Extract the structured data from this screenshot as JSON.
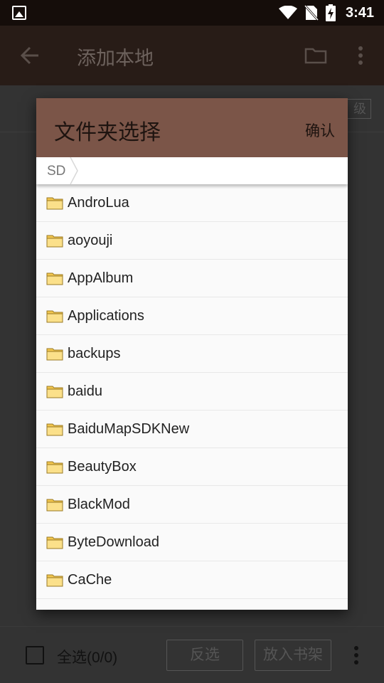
{
  "status_bar": {
    "time": "3:41"
  },
  "app_bar": {
    "title": "添加本地"
  },
  "page": {
    "chip_label": "级"
  },
  "bottom_bar": {
    "select_all_label": "全选(0/0)",
    "invert_label": "反选",
    "add_to_shelf_label": "放入书架"
  },
  "dialog": {
    "title": "文件夹选择",
    "confirm_label": "确认",
    "breadcrumb": "SD",
    "folders": [
      "AndroLua",
      "aoyouji",
      "AppAlbum",
      "Applications",
      "backups",
      "baidu",
      "BaiduMapSDKNew",
      "BeautyBox",
      "BlackMod",
      "ByteDownload",
      "CaChe"
    ]
  },
  "colors": {
    "dialog_header": "#7b5548",
    "status_bar": "#150d0a",
    "app_bar": "#281c17",
    "folder_icon": "#f2c64e"
  }
}
